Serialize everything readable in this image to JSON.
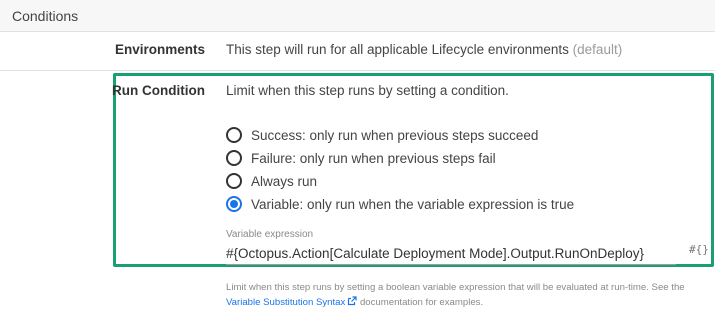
{
  "header": {
    "title": "Conditions"
  },
  "environments": {
    "label": "Environments",
    "value": "This step will run for all applicable Lifecycle environments",
    "suffix": "(default)"
  },
  "run_condition": {
    "label": "Run Condition",
    "description": "Limit when this step runs by setting a condition.",
    "options": [
      {
        "label": "Success: only run when previous steps succeed",
        "selected": false
      },
      {
        "label": "Failure: only run when previous steps fail",
        "selected": false
      },
      {
        "label": "Always run",
        "selected": false
      },
      {
        "label": "Variable: only run when the variable expression is true",
        "selected": true
      }
    ],
    "variable_expression": {
      "caption": "Variable expression",
      "value": "#{Octopus.Action[Calculate Deployment Mode].Output.RunOnDeploy}",
      "insert_icon_text": "#{}"
    },
    "help": {
      "text_before": "Limit when this step runs by setting a boolean variable expression that will be evaluated at run-time. See the",
      "link_text": "Variable Substitution Syntax",
      "text_after": "documentation for examples."
    }
  },
  "colors": {
    "highlight_border": "#1a9e74",
    "radio_selected": "#1a73e8",
    "link": "#1a73e8"
  },
  "icons": {
    "external_link": "external-link-icon"
  }
}
